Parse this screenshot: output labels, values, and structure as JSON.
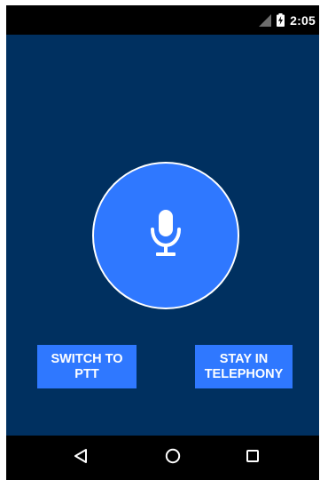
{
  "status_bar": {
    "time": "2:05",
    "icons": [
      "signal-icon",
      "battery-charging-icon"
    ]
  },
  "mic": {
    "icon": "microphone-icon"
  },
  "buttons": {
    "switch_label": "SWITCH TO\nPTT",
    "stay_label": "STAY IN\nTELEPHONY"
  },
  "nav_bar": {
    "icons": [
      "back-icon",
      "home-icon",
      "recents-icon"
    ]
  },
  "colors": {
    "background": "#003060",
    "accent": "#2f78ff",
    "bars": "#000000",
    "text": "#ffffff"
  }
}
